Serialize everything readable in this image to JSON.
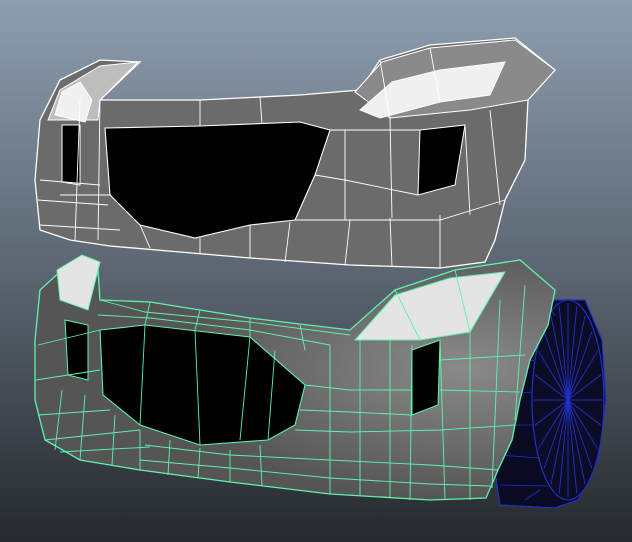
{
  "viewport": {
    "background_top": "#8e9eb0",
    "background_bottom": "#26292d"
  },
  "upper_mesh": {
    "state": "unselected",
    "surface_color": "#6b6b6b",
    "highlight_color": "#f0f0f0",
    "wire_color": "#ffffff"
  },
  "lower_mesh": {
    "state": "selected",
    "surface_color": "#5f5f5f",
    "highlight_color": "#e4e4e4",
    "wire_color": "#5ef2b0"
  },
  "wheel": {
    "fill_color": "#0a0a22",
    "wire_color": "#2030c8"
  }
}
